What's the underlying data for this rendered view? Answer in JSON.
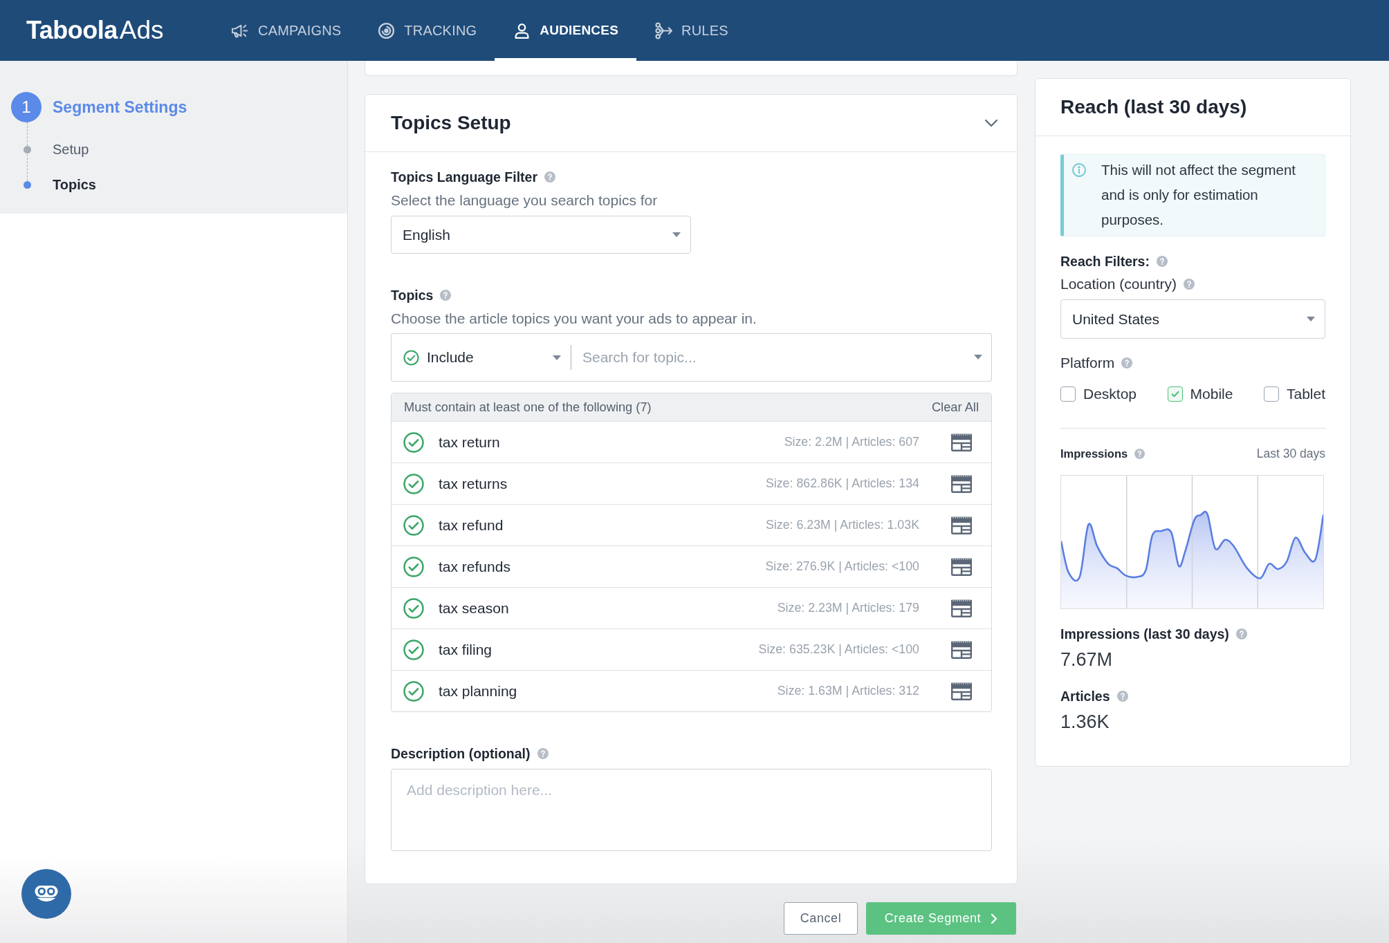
{
  "top_nav": {
    "logo": {
      "brand": "Taboola",
      "product": "Ads"
    },
    "items": [
      {
        "label": "CAMPAIGNS",
        "selected": false
      },
      {
        "label": "TRACKING",
        "selected": false
      },
      {
        "label": "AUDIENCES",
        "selected": true
      },
      {
        "label": "RULES",
        "selected": false
      }
    ]
  },
  "sidebar": {
    "step": {
      "number": "1",
      "title": "Segment Settings"
    },
    "substeps": [
      {
        "label": "Setup",
        "selected": false
      },
      {
        "label": "Topics",
        "selected": true
      }
    ]
  },
  "topics_setup": {
    "title": "Topics Setup",
    "language_filter": {
      "label": "Topics Language Filter",
      "hint": "Select the language you search topics for",
      "value": "English"
    },
    "topics": {
      "label": "Topics",
      "hint": "Choose the article topics you want your ads to appear in.",
      "mode": "Include",
      "search": {
        "placeholder": "Search for topic..."
      }
    },
    "selected_topics": {
      "header": "Must contain at least one of the following (7)",
      "clear_all": "Clear All",
      "rows": [
        {
          "name": "tax return",
          "stats": "Size: 2.2M | Articles: 607"
        },
        {
          "name": "tax returns",
          "stats": "Size: 862.86K | Articles: 134"
        },
        {
          "name": "tax refund",
          "stats": "Size: 6.23M | Articles: 1.03K"
        },
        {
          "name": "tax refunds",
          "stats": "Size: 276.9K | Articles: <100"
        },
        {
          "name": "tax season",
          "stats": "Size: 2.23M | Articles: 179"
        },
        {
          "name": "tax filing",
          "stats": "Size: 635.23K | Articles: <100"
        },
        {
          "name": "tax planning",
          "stats": "Size: 1.63M | Articles: 312"
        }
      ]
    },
    "description": {
      "label": "Description (optional)",
      "placeholder": "Add description here..."
    }
  },
  "actions": {
    "cancel": "Cancel",
    "create": "Create Segment"
  },
  "reach": {
    "title": "Reach (last 30 days)",
    "notice": "This will not affect the segment and is only for estimation purposes.",
    "filters_label": "Reach Filters:",
    "location": {
      "label": "Location (country)",
      "value": "United States"
    },
    "platform": {
      "label": "Platform",
      "options": [
        {
          "label": "Desktop",
          "checked": false
        },
        {
          "label": "Mobile",
          "checked": true
        },
        {
          "label": "Tablet",
          "checked": false
        }
      ]
    },
    "impressions_chart": {
      "label": "Impressions",
      "range": "Last 30 days"
    },
    "stats": [
      {
        "label": "Impressions (last 30 days)",
        "value": "7.67M"
      },
      {
        "label": "Articles",
        "value": "1.36K"
      }
    ]
  }
}
